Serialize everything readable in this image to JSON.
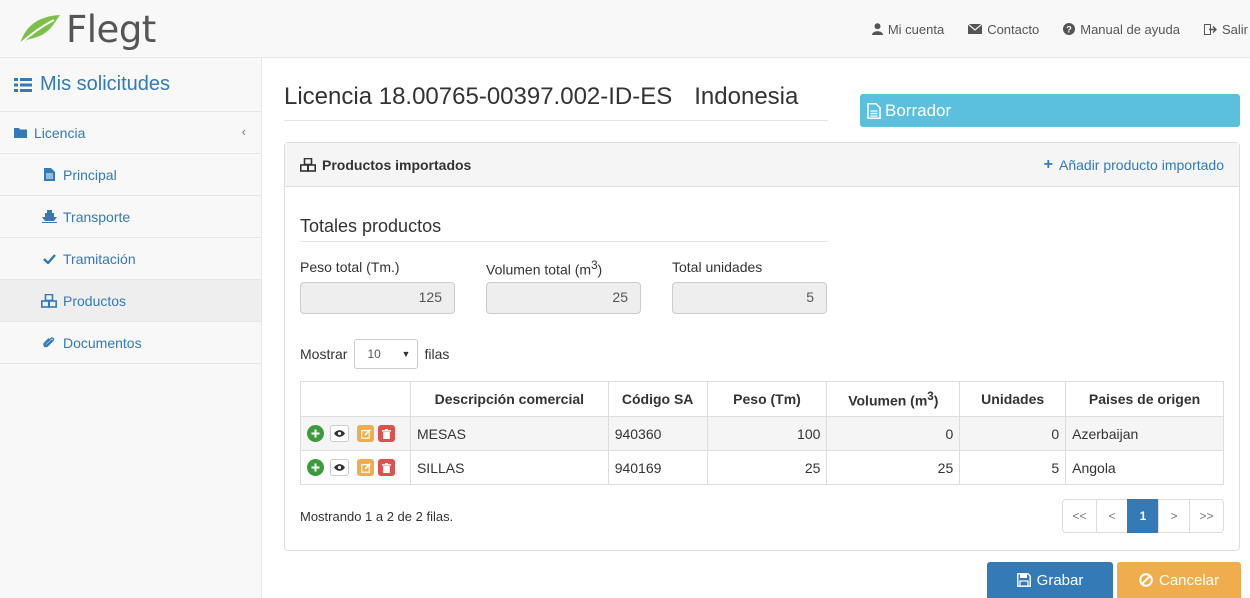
{
  "app": {
    "logo_text": "Flegt"
  },
  "topnav": {
    "account": "Mi cuenta",
    "contact": "Contacto",
    "help": "Manual de ayuda",
    "logout": "Salir"
  },
  "sidebar": {
    "title": "Mis solicitudes",
    "group_label": "Licencia",
    "items": [
      {
        "label": "Principal",
        "icon": "file-icon"
      },
      {
        "label": "Transporte",
        "icon": "ship-icon"
      },
      {
        "label": "Tramitación",
        "icon": "check-icon"
      },
      {
        "label": "Productos",
        "icon": "cubes-icon"
      },
      {
        "label": "Documentos",
        "icon": "paperclip-icon"
      }
    ]
  },
  "page": {
    "title": "Licencia 18.00765-00397.002-ID-ES",
    "country": "Indonesia",
    "status": "Borrador",
    "status_color": "#5bc0de"
  },
  "panel": {
    "title": "Productos importados",
    "add_link": "Añadir producto importado"
  },
  "totals": {
    "title": "Totales productos",
    "weight_label": "Peso total (Tm.)",
    "volume_label_prefix": "Volumen total (m",
    "volume_label_sup": "3",
    "volume_label_suffix": ")",
    "units_label": "Total unidades",
    "weight_value": "125",
    "volume_value": "25",
    "units_value": "5"
  },
  "table_controls": {
    "show_label": "Mostrar",
    "page_size": "10",
    "rows_label": "filas"
  },
  "table": {
    "headers": {
      "description": "Descripción comercial",
      "code": "Código SA",
      "weight": "Peso (Tm)",
      "volume_prefix": "Volumen (m",
      "volume_sup": "3",
      "volume_suffix": ")",
      "units": "Unidades",
      "countries": "Paises de origen"
    },
    "rows": [
      {
        "description": "MESAS",
        "code": "940360",
        "weight": "100",
        "volume": "0",
        "units": "0",
        "country": "Azerbaijan"
      },
      {
        "description": "SILLAS",
        "code": "940169",
        "weight": "25",
        "volume": "25",
        "units": "5",
        "country": "Angola"
      }
    ]
  },
  "pagination": {
    "summary": "Mostrando 1 a 2 de 2 filas.",
    "first": "<<",
    "prev": "<",
    "current": "1",
    "next": ">",
    "last": ">>"
  },
  "actions": {
    "save": "Grabar",
    "cancel": "Cancelar",
    "save_color": "#337ab7",
    "cancel_color": "#f0ad4e"
  }
}
